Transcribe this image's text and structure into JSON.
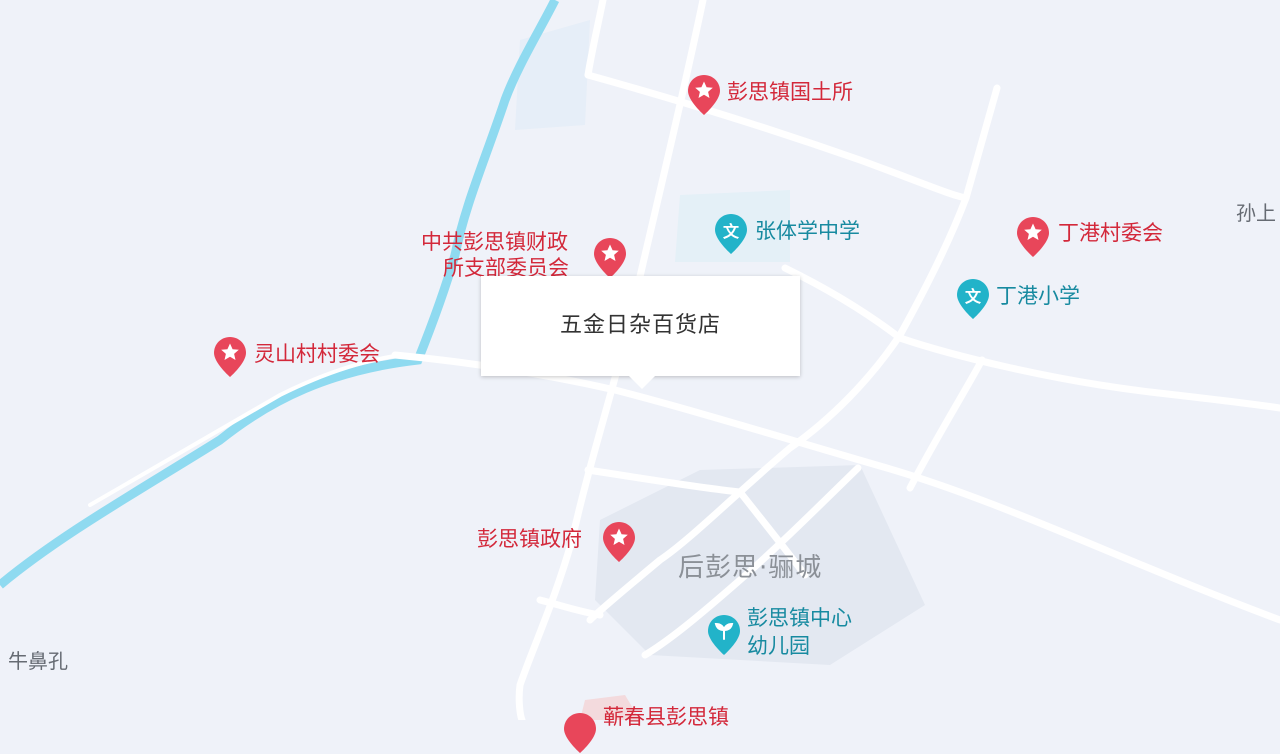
{
  "popup": {
    "title": "五金日杂百货店"
  },
  "places": {
    "guotusuo": "彭思镇国土所",
    "caizheng_line1": "中共彭思镇财政",
    "caizheng_line2": "所支部委员会",
    "zhangti": "张体学中学",
    "dinggang_cwh": "丁港村委会",
    "dinggang_xx": "丁港小学",
    "lingshan": "灵山村村委会",
    "zhengfu": "彭思镇政府",
    "district": "后彭思·骊城",
    "youeryuan_line1": "彭思镇中心",
    "youeryuan_line2": "幼儿园",
    "niubikong": "牛鼻孔",
    "sunshang": "孙上",
    "bottom_partial": "蕲春县彭思镇"
  },
  "icons": {
    "government": "star-pin-icon",
    "school": "school-pin-icon",
    "kindergarten": "kindergarten-pin-icon"
  },
  "colors": {
    "background": "#eff2f9",
    "road": "#ffffff",
    "river": "#8fdaf0",
    "gov_label": "#d3283a",
    "school_label": "#178aa0"
  }
}
